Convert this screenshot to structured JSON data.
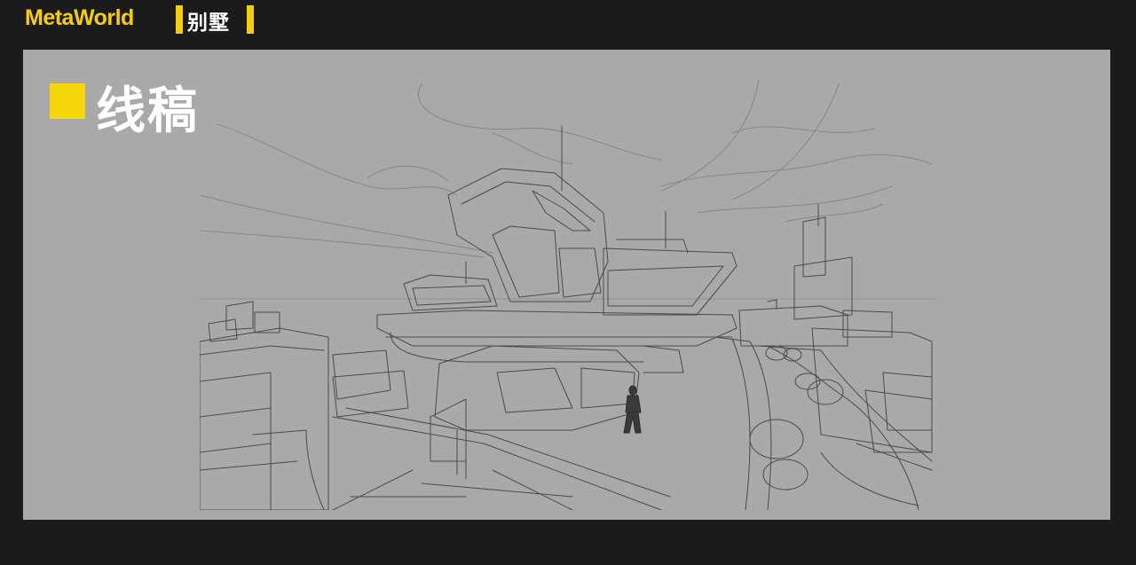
{
  "header": {
    "brand": "MetaWorld",
    "category": "别墅"
  },
  "section": {
    "title": "线稿"
  },
  "colors": {
    "accent": "#f5cf0a",
    "stage": "#a9a9a9",
    "bar": "#1b1b1b"
  }
}
